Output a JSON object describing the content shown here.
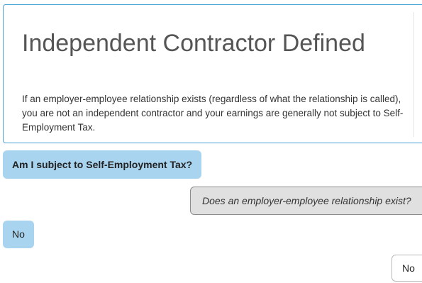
{
  "info_card": {
    "title": "Independent Contractor Defined",
    "body": "If an employer-employee relationship exists (regardless of what the relationship is called), you are not an independent contractor and your earnings are generally not subject to Self-Employment Tax."
  },
  "conversation": {
    "question": "Am I subject to Self-Employment Tax?",
    "prompt": "Does an employer-employee relationship exist?",
    "previous_answer": "No",
    "answer_option": "No"
  },
  "colors": {
    "accent_border": "#4aa3d6",
    "user_bubble": "#a9d4ef",
    "prompt_bubble": "#e0e0e0"
  }
}
